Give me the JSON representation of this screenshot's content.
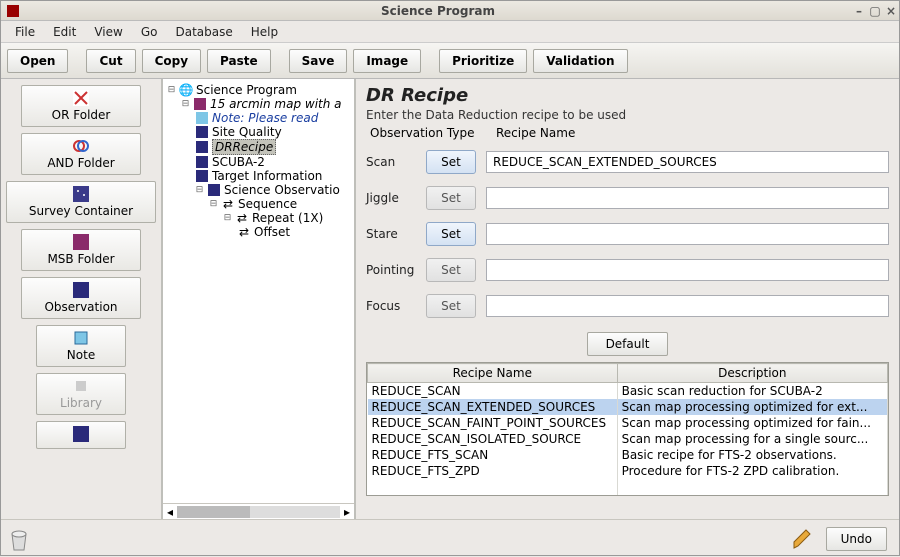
{
  "window": {
    "title": "Science Program"
  },
  "menubar": [
    "File",
    "Edit",
    "View",
    "Go",
    "Database",
    "Help"
  ],
  "toolbar": [
    "Open",
    "Cut",
    "Copy",
    "Paste",
    "Save",
    "Image",
    "Prioritize",
    "Validation"
  ],
  "palette": [
    {
      "label": "OR Folder",
      "icon": "or-folder-icon"
    },
    {
      "label": "AND Folder",
      "icon": "and-folder-icon"
    },
    {
      "label": "Survey Container",
      "icon": "survey-icon",
      "wide": true
    },
    {
      "label": "MSB Folder",
      "icon": "msb-icon"
    },
    {
      "label": "Observation",
      "icon": "obs-icon"
    },
    {
      "label": "Note",
      "icon": "note-palette-icon",
      "small": true
    },
    {
      "label": "Library",
      "icon": "library-icon",
      "small": true,
      "disabled": true
    },
    {
      "label": "",
      "icon": "blank-icon",
      "small": true
    }
  ],
  "tree": {
    "root": "Science Program",
    "n1": "15 arcmin map with a",
    "note": "Note: Please read",
    "sq": "Site Quality",
    "dr": "DRRecipe",
    "scuba2": "SCUBA-2",
    "tgt": "Target Information",
    "sciobs": "Science Observatio",
    "seq": "Sequence",
    "rep": "Repeat (1X)",
    "off": "Offset"
  },
  "panel": {
    "title": "DR Recipe",
    "subtitle": "Enter the Data Reduction recipe to be used",
    "hdr_obs": "Observation Type",
    "hdr_rec": "Recipe Name",
    "rows": [
      {
        "label": "Scan",
        "enabled": true,
        "value": "REDUCE_SCAN_EXTENDED_SOURCES"
      },
      {
        "label": "Jiggle",
        "enabled": false,
        "value": ""
      },
      {
        "label": "Stare",
        "enabled": true,
        "value": ""
      },
      {
        "label": "Pointing",
        "enabled": false,
        "value": ""
      },
      {
        "label": "Focus",
        "enabled": false,
        "value": ""
      }
    ],
    "set_label": "Set",
    "default_btn": "Default",
    "table": {
      "cols": [
        "Recipe Name",
        "Description"
      ],
      "rows": [
        {
          "name": "REDUCE_SCAN",
          "desc": "Basic scan reduction for SCUBA-2"
        },
        {
          "name": "REDUCE_SCAN_EXTENDED_SOURCES",
          "desc": "Scan map processing optimized for ext...",
          "sel": true
        },
        {
          "name": "REDUCE_SCAN_FAINT_POINT_SOURCES",
          "desc": "Scan map processing optimized for fain..."
        },
        {
          "name": "REDUCE_SCAN_ISOLATED_SOURCE",
          "desc": "Scan map processing for a single sourc..."
        },
        {
          "name": "REDUCE_FTS_SCAN",
          "desc": "Basic recipe for FTS-2 observations."
        },
        {
          "name": "REDUCE_FTS_ZPD",
          "desc": "Procedure for FTS-2 ZPD calibration."
        }
      ]
    }
  },
  "footer": {
    "undo": "Undo"
  }
}
